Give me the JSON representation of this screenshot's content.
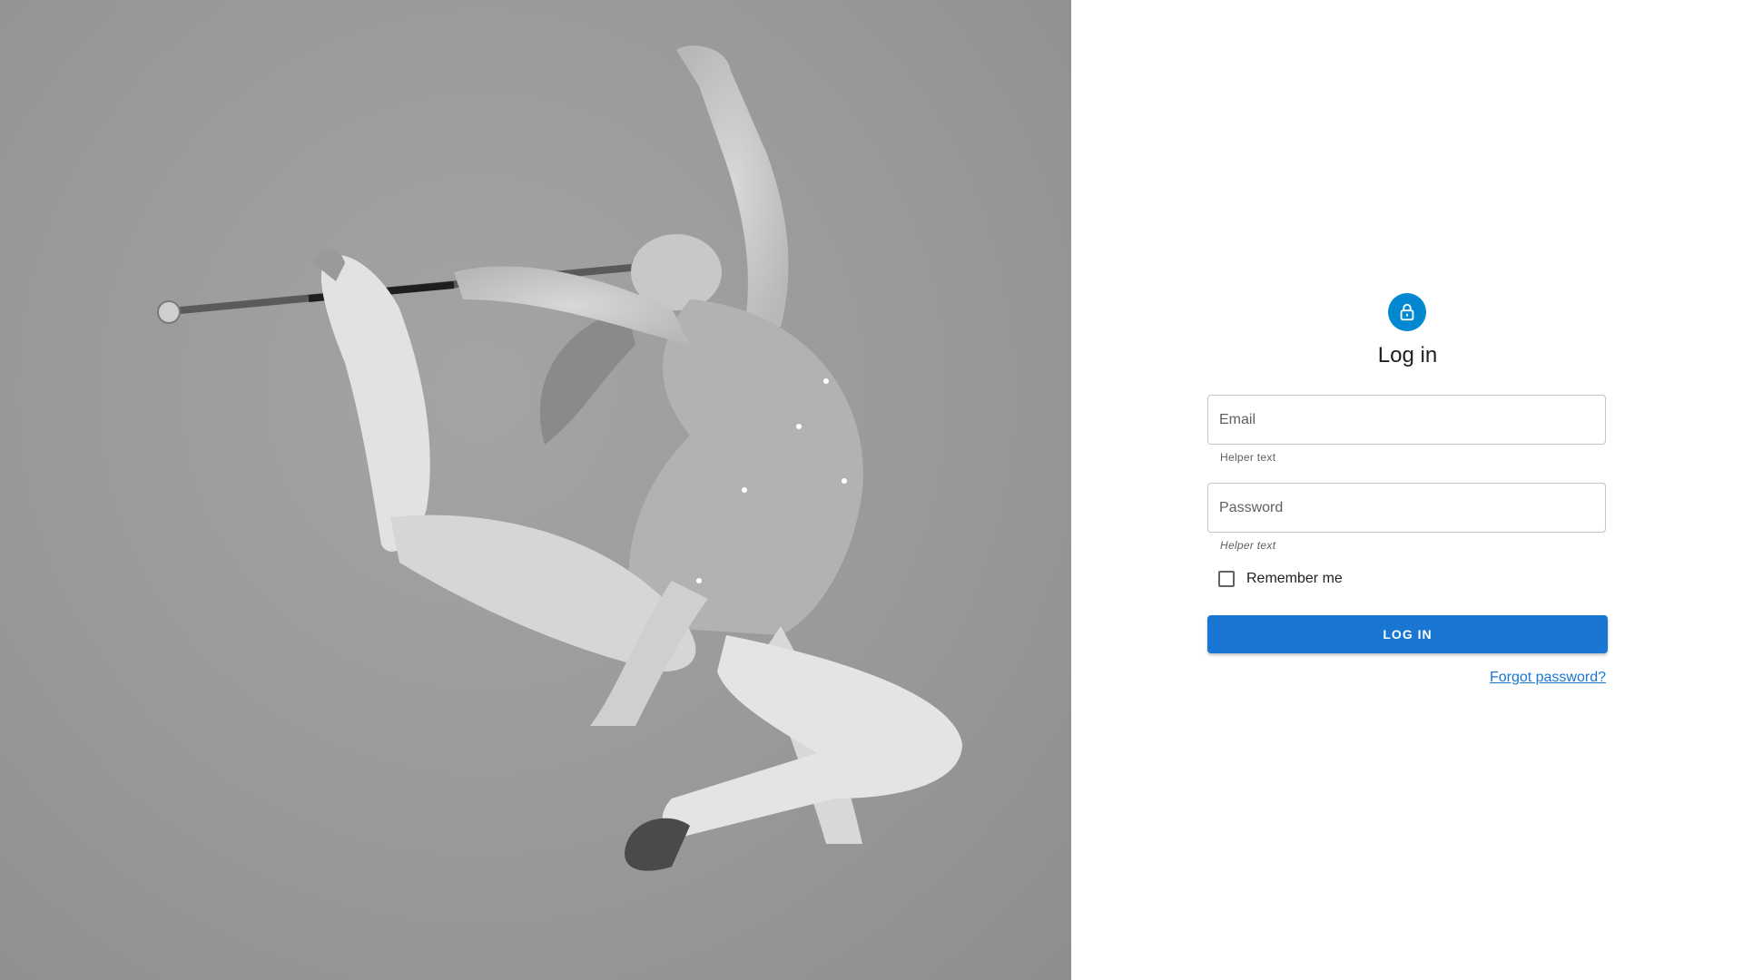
{
  "hero": {
    "image_alt": "Baton twirler leaping mid-air, black and white photograph"
  },
  "login_form": {
    "title": "Log in",
    "lock_icon": "lock-icon",
    "email": {
      "placeholder": "Email",
      "value": "",
      "helper_text": "Helper text"
    },
    "password": {
      "placeholder": "Password",
      "value": "",
      "helper_text": "Helper text"
    },
    "remember_me": {
      "label": "Remember me",
      "checked": false
    },
    "submit_label": "LOG IN",
    "forgot_password_label": "Forgot password?"
  },
  "colors": {
    "accent": "#1976d2",
    "avatar": "#0288d1"
  }
}
